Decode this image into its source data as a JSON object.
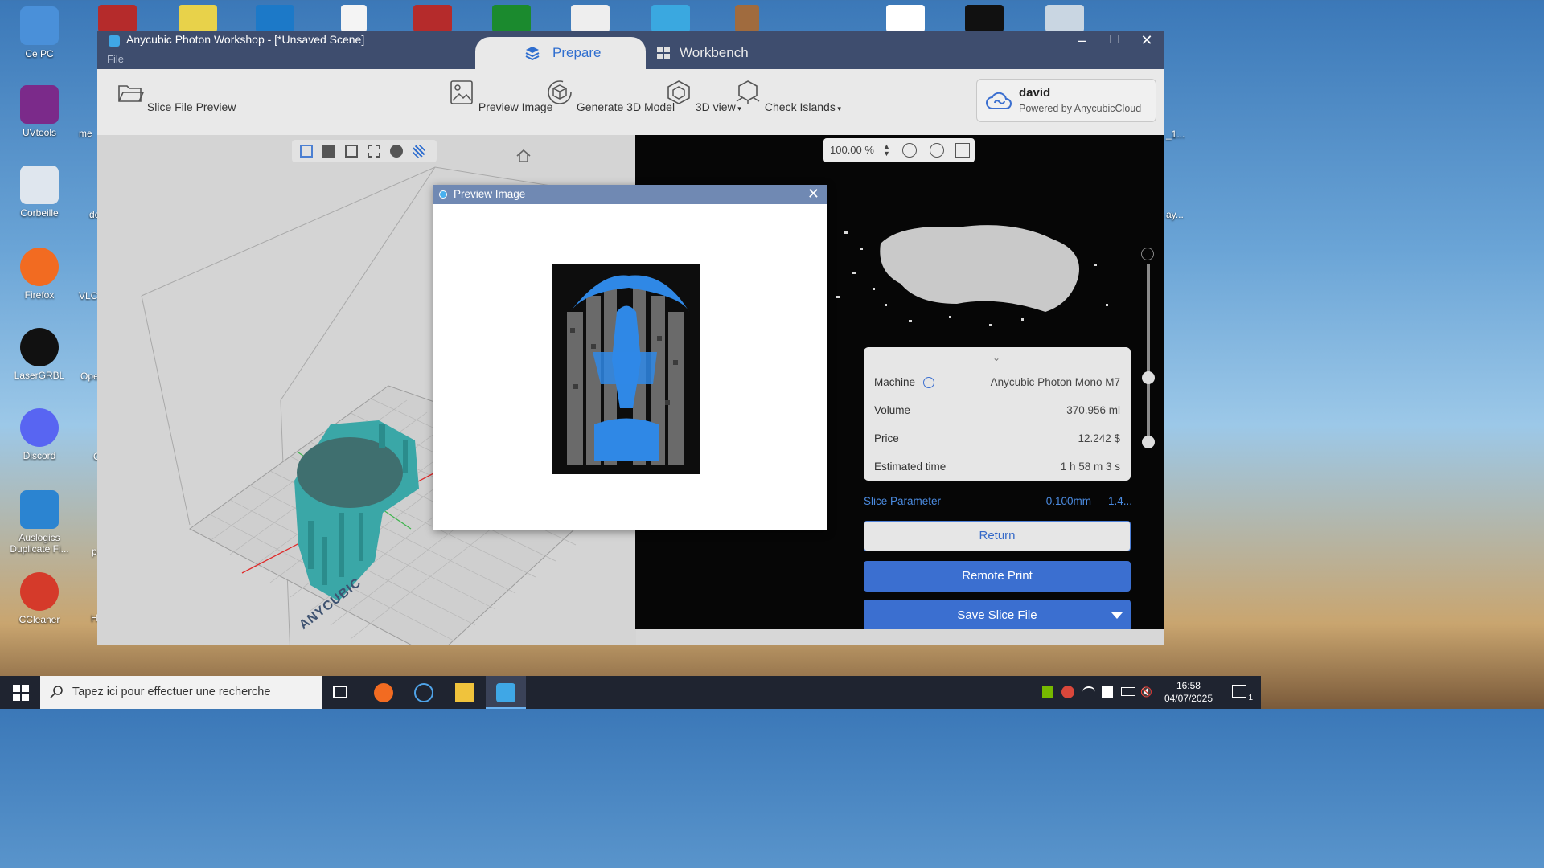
{
  "desktop": {
    "icons": [
      {
        "label": "Ce PC",
        "color": "#4a90d9"
      },
      {
        "label": "UVtools",
        "color": "#7b2a8a"
      },
      {
        "label": "Corbeille",
        "color": "#dfe6ee"
      },
      {
        "label": "Firefox",
        "color": "#f26b21"
      },
      {
        "label": "LaserGRBL",
        "color": "#111111"
      },
      {
        "label": "Discord",
        "color": "#5865f2"
      },
      {
        "label": "Auslogics Duplicate Fi...",
        "color": "#2b84d1"
      },
      {
        "label": "CCleaner",
        "color": "#d53a2a"
      }
    ],
    "partial_labels": [
      "me",
      "de",
      "VLC",
      "Ope",
      "C",
      "p",
      "H"
    ],
    "right_partial": [
      "_1...",
      "ay..."
    ]
  },
  "window": {
    "title": "Anycubic Photon Workshop - [*Unsaved Scene]",
    "menu_file": "File",
    "tabs": {
      "prepare": "Prepare",
      "workbench": "Workbench"
    },
    "toolbar": {
      "slice_file_preview": "Slice File Preview",
      "preview_image": "Preview Image",
      "generate_3d": "Generate 3D Model",
      "view_3d": "3D view",
      "check_islands": "Check Islands"
    },
    "user": {
      "name": "david",
      "powered": "Powered by AnycubicCloud"
    }
  },
  "plate_brand": "ANYCUBIC",
  "zoom": {
    "value": "100.00 %"
  },
  "info": {
    "machine_label": "Machine",
    "machine_value": "Anycubic Photon Mono M7",
    "volume_label": "Volume",
    "volume_value": "370.956 ml",
    "price_label": "Price",
    "price_value": "12.242 $",
    "time_label": "Estimated time",
    "time_value": "1 h 58 m 3 s"
  },
  "slice_param": {
    "label": "Slice Parameter",
    "value": "0.100mm — 1.4..."
  },
  "buttons": {
    "return": "Return",
    "remote_print": "Remote Print",
    "save_slice": "Save Slice File"
  },
  "dialog": {
    "title": "Preview Image"
  },
  "taskbar": {
    "search_placeholder": "Tapez ici pour effectuer une recherche",
    "time": "16:58",
    "date": "04/07/2025",
    "notifications": "1"
  },
  "colors": {
    "accent": "#3b6fd0",
    "titlebar": "#3e4d6e",
    "model": "#3aa7a7",
    "preview_blue": "#2f88e6"
  }
}
